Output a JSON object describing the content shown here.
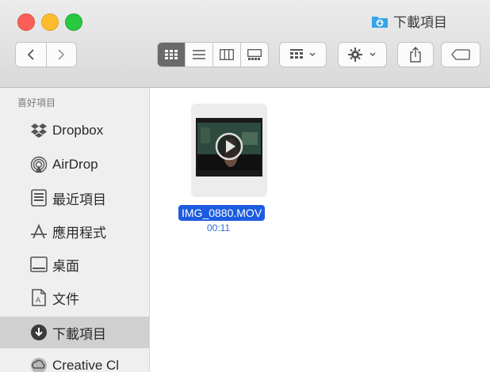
{
  "window": {
    "title": "下載項目"
  },
  "toolbar": {
    "nav": {
      "back": "back",
      "forward": "forward"
    },
    "views": [
      "icon",
      "list",
      "column",
      "gallery"
    ],
    "active_view": "icon"
  },
  "sidebar": {
    "section_title": "喜好項目",
    "items": [
      {
        "label": "Dropbox",
        "icon": "dropbox-icon"
      },
      {
        "label": "AirDrop",
        "icon": "airdrop-icon"
      },
      {
        "label": "最近項目",
        "icon": "recents-icon"
      },
      {
        "label": "應用程式",
        "icon": "applications-icon"
      },
      {
        "label": "桌面",
        "icon": "desktop-icon"
      },
      {
        "label": "文件",
        "icon": "documents-icon"
      },
      {
        "label": "下載項目",
        "icon": "downloads-icon",
        "selected": true
      },
      {
        "label": "Creative Cl",
        "icon": "creative-cloud-icon"
      }
    ]
  },
  "content": {
    "files": [
      {
        "name": "IMG_0880.MOV",
        "duration": "00:11"
      }
    ]
  },
  "colors": {
    "selection": "#1d5ce0",
    "accent": "#2f6ad8"
  }
}
